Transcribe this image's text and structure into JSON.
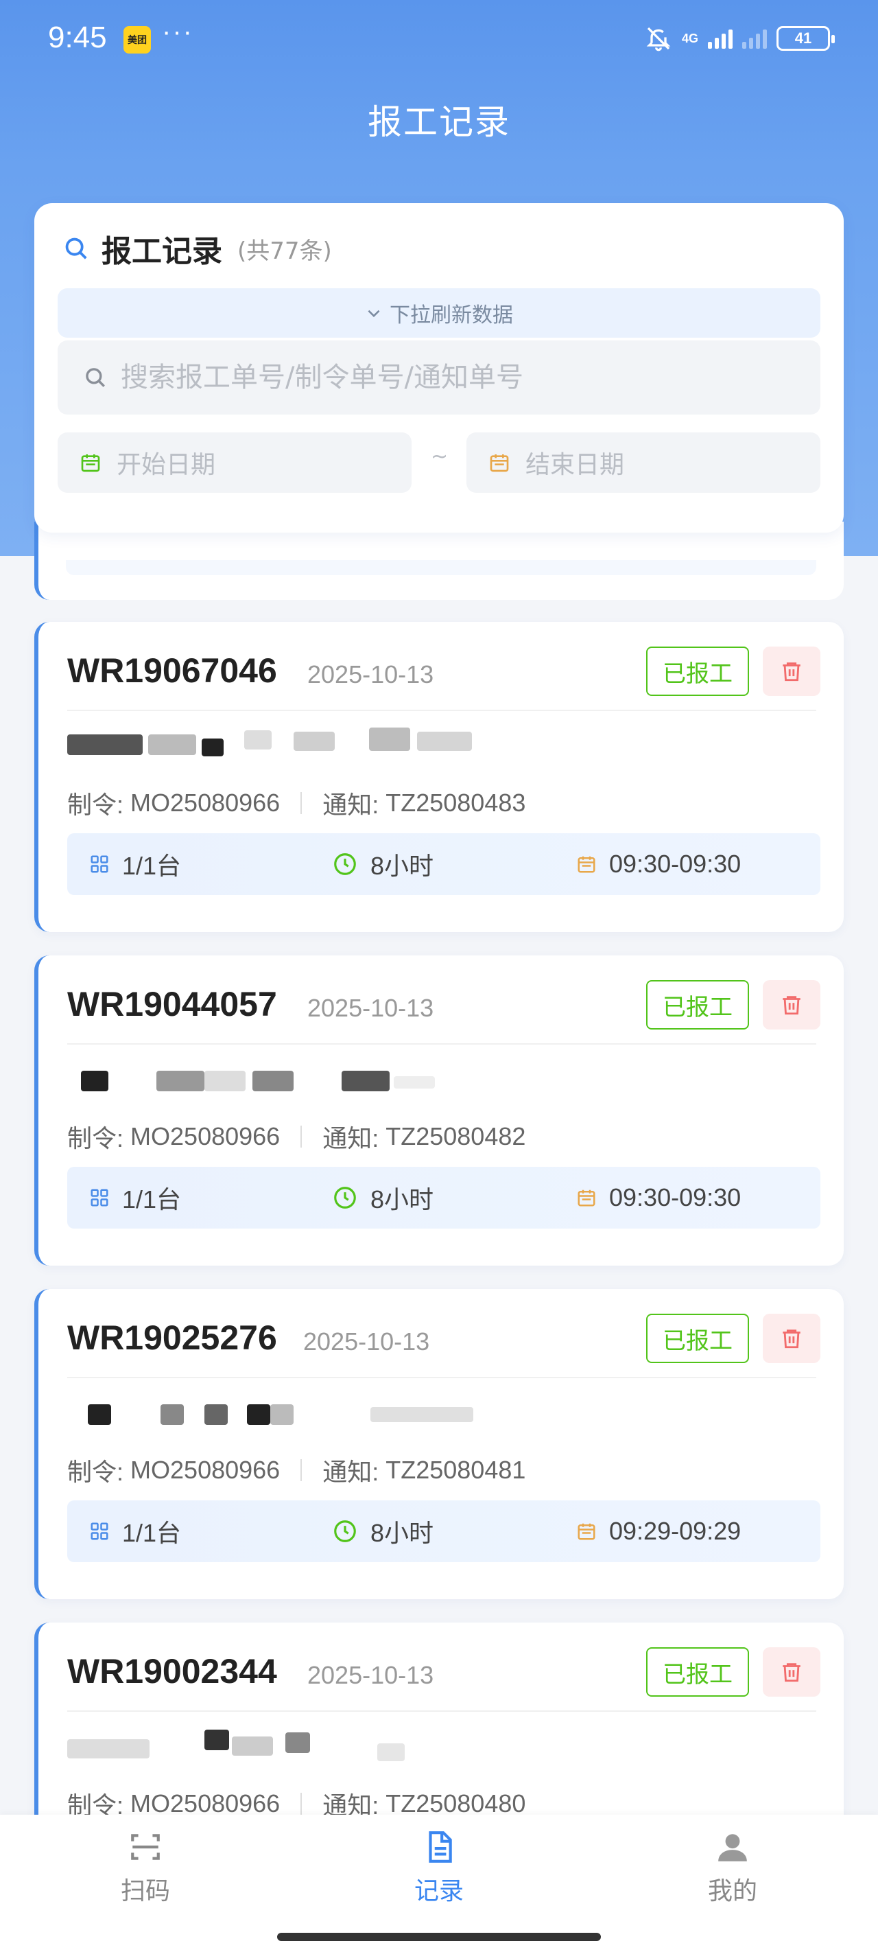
{
  "status_bar": {
    "time": "9:45",
    "app_badge": "美团",
    "more": "···",
    "network": "4G",
    "battery": "41"
  },
  "header": {
    "title": "报工记录"
  },
  "search_card": {
    "title": "报工记录",
    "count": "(共77条)",
    "refresh_hint": "下拉刷新数据",
    "search_placeholder": "搜索报工单号/制令单号/通知单号",
    "start_date_placeholder": "开始日期",
    "end_date_placeholder": "结束日期",
    "date_separator": "~"
  },
  "labels": {
    "order_prefix": "制令:",
    "notice_prefix": "通知:"
  },
  "records": [
    {
      "id": "WR19067046",
      "date": "2025-10-13",
      "status": "已报工",
      "order": "MO25080966",
      "notice": "TZ25080483",
      "qty": "1/1台",
      "hours": "8小时",
      "time": "09:30-09:30"
    },
    {
      "id": "WR19044057",
      "date": "2025-10-13",
      "status": "已报工",
      "order": "MO25080966",
      "notice": "TZ25080482",
      "qty": "1/1台",
      "hours": "8小时",
      "time": "09:30-09:30"
    },
    {
      "id": "WR19025276",
      "date": "2025-10-13",
      "status": "已报工",
      "order": "MO25080966",
      "notice": "TZ25080481",
      "qty": "1/1台",
      "hours": "8小时",
      "time": "09:29-09:29"
    },
    {
      "id": "WR19002344",
      "date": "2025-10-13",
      "status": "已报工",
      "order": "MO25080966",
      "notice": "TZ25080480",
      "qty": "",
      "hours": "",
      "time": ""
    }
  ],
  "bottom_nav": {
    "scan": "扫码",
    "records": "记录",
    "mine": "我的"
  },
  "colors": {
    "primary": "#3a86f0",
    "success": "#52c41a",
    "danger": "#f26b6b",
    "clock": "#52c41a",
    "calendar": "#e8a74a",
    "grid": "#4a8ce8"
  }
}
